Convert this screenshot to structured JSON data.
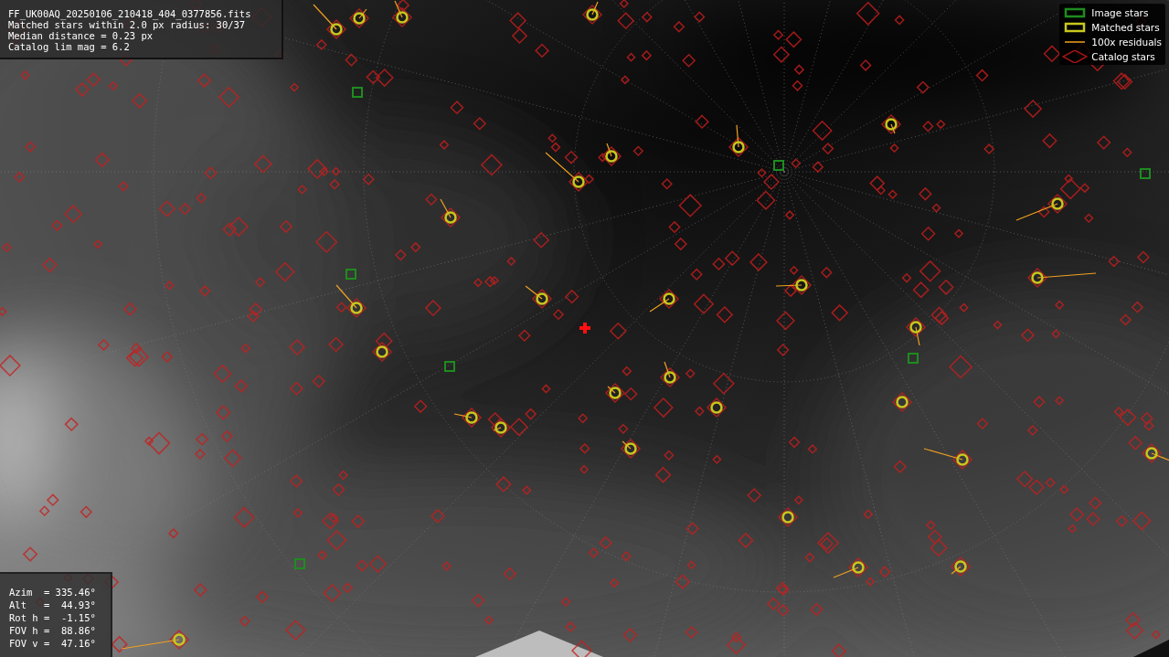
{
  "file_info": [
    "FF_UK00AQ_20250106_210418_404_0377856.fits",
    "Matched stars within 2.0 px radius: 30/37",
    "Median distance = 0.23 px",
    "Catalog lim mag = 6.2"
  ],
  "legend": [
    {
      "label": "Image stars"
    },
    {
      "kind": "matched",
      "label": "Matched stars"
    },
    {
      "kind": "residual",
      "label": "100x residuals"
    },
    {
      "kind": "catalog",
      "label": "Catalog stars"
    }
  ],
  "pointing": [
    "Azim  = 335.46°",
    "Alt   =  44.93°",
    "Rot h =  -1.15°",
    "FOV h =  88.86°",
    "FOV v =  47.16°"
  ]
}
